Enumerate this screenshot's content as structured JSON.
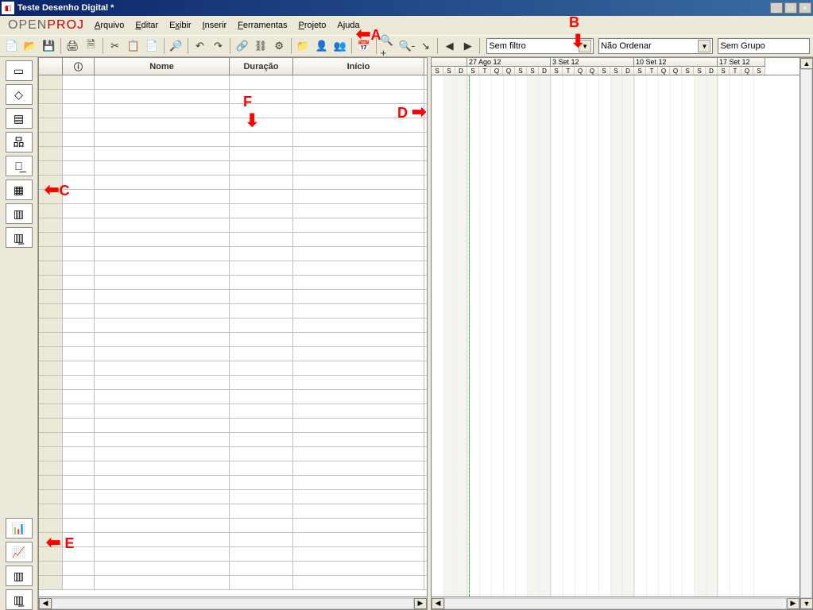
{
  "window": {
    "title": "Teste Desenho Digital *"
  },
  "logo": {
    "part1": "OPEN",
    "part2": "PROJ"
  },
  "menu": {
    "arquivo": "Arquivo",
    "editar": "Editar",
    "exibir": "Exibir",
    "inserir": "Inserir",
    "ferramentas": "Ferramentas",
    "projeto": "Projeto",
    "ajuda": "Ajuda"
  },
  "filters": {
    "filter": "Sem filtro",
    "sort": "Não Ordenar",
    "group": "Sem Grupo"
  },
  "table": {
    "columns": {
      "info": "ⓘ",
      "nome": "Nome",
      "duracao": "Duração",
      "inicio": "Início"
    }
  },
  "timeline": {
    "weeks": [
      "27 Ago 12",
      "3 Set 12",
      "10 Set 12",
      "17 Set 12"
    ],
    "days": [
      "S",
      "S",
      "D",
      "S",
      "T",
      "Q",
      "Q",
      "S",
      "S",
      "D",
      "S",
      "T",
      "Q",
      "Q",
      "S",
      "S",
      "D",
      "S",
      "T",
      "Q",
      "Q",
      "S",
      "S",
      "D",
      "S",
      "T",
      "Q",
      "S"
    ]
  },
  "annotations": {
    "A": "A",
    "B": "B",
    "C": "C",
    "D": "D",
    "E": "E",
    "F": "F"
  }
}
